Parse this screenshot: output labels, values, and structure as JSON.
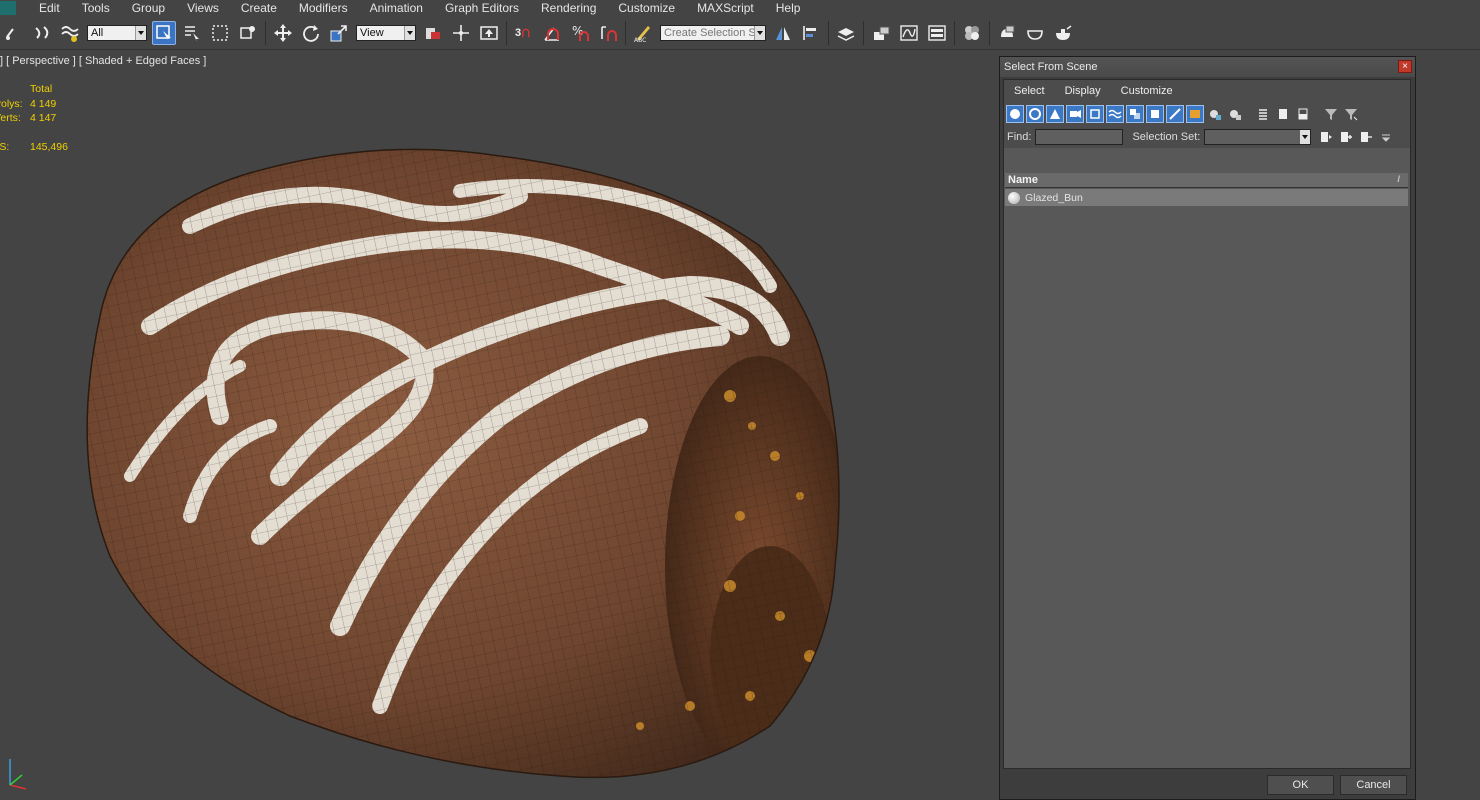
{
  "menu": {
    "items": [
      "Edit",
      "Tools",
      "Group",
      "Views",
      "Create",
      "Modifiers",
      "Animation",
      "Graph Editors",
      "Rendering",
      "Customize",
      "MAXScript",
      "Help"
    ]
  },
  "toolbar": {
    "selection_filter": "All",
    "reference_coord": "View",
    "snap_label": "3",
    "named_selection_placeholder": "Create Selection Se"
  },
  "viewport": {
    "label": "] [ Perspective ] [ Shaded + Edged Faces ]",
    "stats": {
      "header": "Total",
      "polys_label": "Polys:",
      "polys_value": "4 149",
      "verts_label": "Verts:",
      "verts_value": "4 147",
      "fps_label": "FPS:",
      "fps_value": "145,496"
    }
  },
  "dialog": {
    "title": "Select From Scene",
    "close_glyph": "×",
    "menu": [
      "Select",
      "Display",
      "Customize"
    ],
    "find_label": "Find:",
    "find_value": "",
    "selection_set_label": "Selection Set:",
    "selection_set_value": "",
    "column_name": "Name",
    "sort_glyph": "/",
    "objects": [
      "Glazed_Bun"
    ],
    "ok_label": "OK",
    "cancel_label": "Cancel"
  },
  "colors": {
    "accent": "#3a74c2",
    "stats": "#f0d000",
    "bun": "#7a4f36",
    "glaze": "#e8e2d8"
  }
}
